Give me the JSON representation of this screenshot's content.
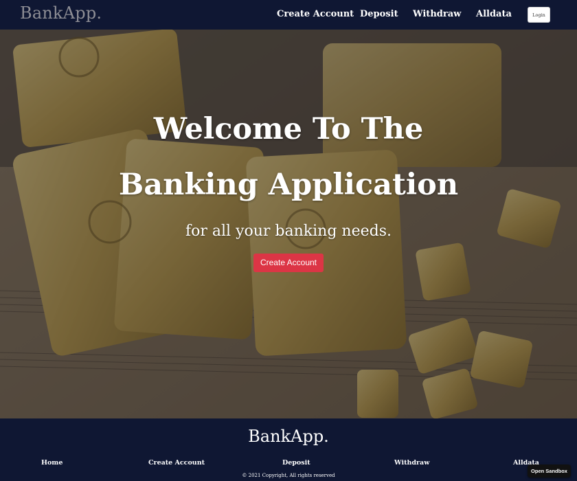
{
  "navbar": {
    "brand": "BankApp.",
    "links": [
      "Create Account",
      "Deposit",
      "Withdraw",
      "Alldata"
    ],
    "login_label": "Login"
  },
  "hero": {
    "title": "Welcome To The Banking Application",
    "subtitle": "for all your banking needs.",
    "cta_label": "Create Account",
    "background_image": "gold-bars-icon"
  },
  "footer": {
    "brand": "BankApp.",
    "links": [
      "Home",
      "Create Account",
      "Deposit",
      "Withdraw",
      "Alldata"
    ],
    "copyright": "© 2021 Copyright, All rights reserved"
  },
  "sandbox": {
    "label": "Open Sandbox"
  },
  "colors": {
    "navbar_bg": "#0f1733",
    "cta_bg": "#dc3545",
    "text_light": "#ffffff",
    "brand_muted": "#8e8e95"
  }
}
